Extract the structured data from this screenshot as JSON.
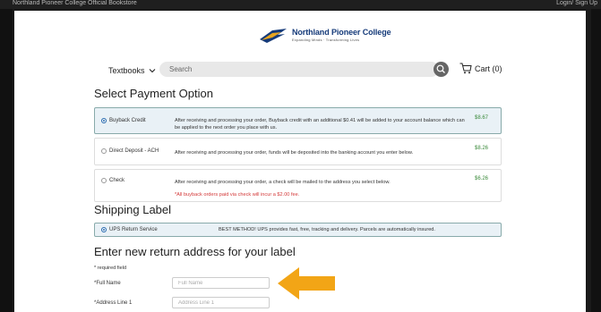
{
  "topbar": {
    "store_title": "Northland Pioneer College Official Bookstore",
    "auth_link": "Login/ Sign Up"
  },
  "logo": {
    "name": "Northland Pioneer College",
    "tagline": "Expanding Minds · Transforming Lives"
  },
  "nav": {
    "textbooks_label": "Textbooks",
    "search_placeholder": "Search",
    "cart_label": "Cart (0)"
  },
  "payment": {
    "heading": "Select Payment Option",
    "options": [
      {
        "label": "Buyback Credit",
        "desc": "After receiving and processing your order, Buyback credit with an additional $0.41 will be added to your account balance which can be applied to the next order you place with us.",
        "amount": "$8.67",
        "selected": true
      },
      {
        "label": "Direct Deposit - ACH",
        "desc": "After receiving and processing your order, funds will be deposited into the banking account you enter below.",
        "amount": "$8.26",
        "selected": false
      },
      {
        "label": "Check",
        "desc": "After receiving and processing your order, a check will be mailed to the address you select below.",
        "amount": "$6.26",
        "note": "*All buyback orders paid via check will incur a $2.00 fee.",
        "selected": false
      }
    ]
  },
  "shipping": {
    "heading": "Shipping Label",
    "option": {
      "label": "UPS Return Service",
      "desc": "BEST METHOD! UPS provides fast, free, tracking and delivery. Parcels are automatically insured.",
      "selected": true
    }
  },
  "address": {
    "heading": "Enter new return address for your label",
    "required_note": "* required field",
    "fields": [
      {
        "label": "*Full Name",
        "placeholder": "Full Name",
        "value": ""
      },
      {
        "label": "*Address Line 1",
        "placeholder": "Address Line 1",
        "value": ""
      }
    ]
  },
  "colors": {
    "accent_blue": "#2b6cb0",
    "price_green": "#3a8a3a",
    "warning_red": "#d43a3a",
    "arrow_orange": "#f2a516",
    "brand_navy": "#163b7a"
  },
  "icons": {
    "chevron": "chevron-down-icon",
    "search": "search-icon",
    "cart": "cart-icon",
    "arrow": "arrow-left-icon"
  }
}
